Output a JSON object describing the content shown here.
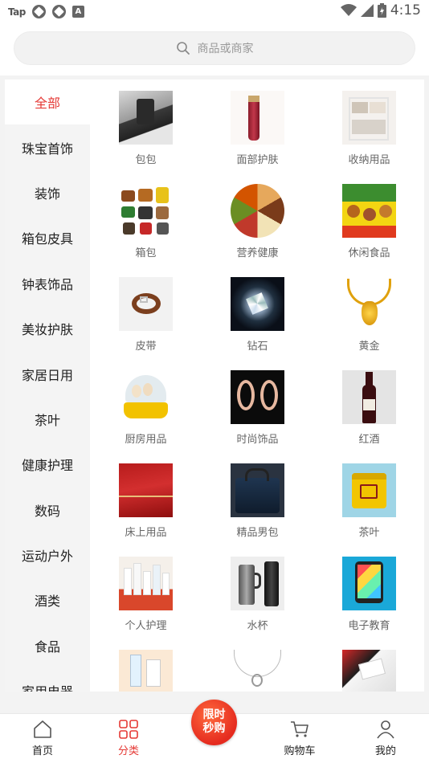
{
  "status_bar": {
    "carrier": "Tap",
    "time": "4:15",
    "badge": "A"
  },
  "search": {
    "placeholder": "商品或商家"
  },
  "sidebar": {
    "items": [
      {
        "label": "全部",
        "active": true
      },
      {
        "label": "珠宝首饰"
      },
      {
        "label": "装饰"
      },
      {
        "label": "箱包皮具"
      },
      {
        "label": "钟表饰品"
      },
      {
        "label": "美妆护肤"
      },
      {
        "label": "家居日用"
      },
      {
        "label": "茶叶"
      },
      {
        "label": "健康护理"
      },
      {
        "label": "数码"
      },
      {
        "label": "运动户外"
      },
      {
        "label": "酒类"
      },
      {
        "label": "食品"
      },
      {
        "label": "家用电器"
      }
    ]
  },
  "categories": [
    {
      "label": "包包",
      "icon": "handbag-image"
    },
    {
      "label": "面部护肤",
      "icon": "skincare-tube-image"
    },
    {
      "label": "收纳用品",
      "icon": "storage-rack-image"
    },
    {
      "label": "箱包",
      "icon": "luggage-image"
    },
    {
      "label": "营养健康",
      "icon": "nutrition-food-image"
    },
    {
      "label": "休闲食品",
      "icon": "snack-food-image"
    },
    {
      "label": "皮带",
      "icon": "belt-image"
    },
    {
      "label": "钻石",
      "icon": "diamond-image"
    },
    {
      "label": "黄金",
      "icon": "gold-necklace-image"
    },
    {
      "label": "厨房用品",
      "icon": "egg-cooker-image"
    },
    {
      "label": "时尚饰品",
      "icon": "earrings-image"
    },
    {
      "label": "红酒",
      "icon": "wine-bottle-image"
    },
    {
      "label": "床上用品",
      "icon": "bedding-image"
    },
    {
      "label": "精品男包",
      "icon": "mens-bag-image"
    },
    {
      "label": "茶叶",
      "icon": "tea-can-image"
    },
    {
      "label": "个人护理",
      "icon": "personal-care-image"
    },
    {
      "label": "水杯",
      "icon": "water-cup-image"
    },
    {
      "label": "电子教育",
      "icon": "edu-tablet-image"
    },
    {
      "label": "",
      "icon": "medical-product-image"
    },
    {
      "label": "",
      "icon": "pendant-necklace-image"
    },
    {
      "label": "",
      "icon": "electronics-image"
    }
  ],
  "bottom_nav": {
    "home": "首页",
    "category": "分类",
    "flash_sale_line1": "限时",
    "flash_sale_line2": "秒购",
    "cart": "购物车",
    "mine": "我的"
  },
  "colors": {
    "accent": "#e53935",
    "sidebar_bg": "#f4f4f4",
    "page_bg": "#f3f3f3"
  }
}
